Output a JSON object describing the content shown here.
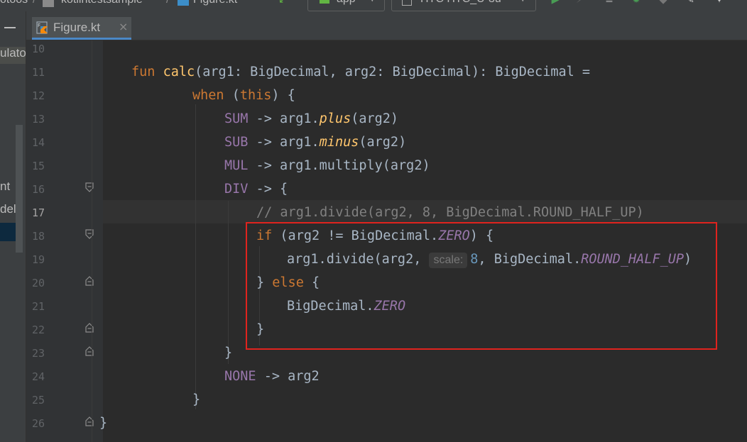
{
  "toolbar": {
    "crumb1": "otoos",
    "crumb2": "kotlintestsample",
    "crumb3": "Figure.kt",
    "run_config": "app",
    "device": "HTC HTC_U-3u"
  },
  "left_panel": {
    "cut_labels": [
      "ulato",
      "nt",
      "del"
    ]
  },
  "tab": {
    "label": "Figure.kt",
    "close": "×"
  },
  "gutter": {
    "line_numbers": [
      "10",
      "11",
      "12",
      "13",
      "14",
      "15",
      "16",
      "17",
      "18",
      "19",
      "20",
      "21",
      "22",
      "23",
      "24",
      "25",
      "26"
    ],
    "current_line": "17"
  },
  "code": {
    "l11": {
      "fun": "fun ",
      "name": "calc",
      "rest": "(arg1: BigDecimal, arg2: BigDecimal): BigDecimal ="
    },
    "l12": {
      "when": "when ",
      "p1": "(",
      "this": "this",
      "p2": ") {"
    },
    "l13": {
      "c": "SUM",
      "mid": " -> arg1.",
      "f": "plus",
      "end": "(arg2)"
    },
    "l14": {
      "c": "SUB",
      "mid": " -> arg1.",
      "f": "minus",
      "end": "(arg2)"
    },
    "l15": {
      "c": "MUL",
      "mid": " -> arg1.multiply(arg2)"
    },
    "l16": {
      "c": "DIV",
      "mid": " -> {"
    },
    "l17": {
      "comment": "// arg1.divide(arg2, 8, BigDecimal.ROUND_HALF_UP)"
    },
    "l18": {
      "if": "if",
      "mid": " (arg2 != BigDecimal.",
      "zero": "ZERO",
      "end": ") {"
    },
    "l19": {
      "start": "arg1.divide(arg2, ",
      "hint": "scale:",
      "num": "8",
      "mid": ", BigDecimal.",
      "round": "ROUND_HALF_UP",
      "end": ")"
    },
    "l20": {
      "close": "} ",
      "else": "else",
      "open": " {"
    },
    "l21": {
      "start": "BigDecimal.",
      "zero": "ZERO"
    },
    "l22": {
      "text": "}"
    },
    "l23": {
      "text": "}"
    },
    "l24": {
      "c": "NONE",
      "mid": " -> arg2"
    },
    "l25": {
      "text": "}"
    },
    "l26": {
      "text": "}"
    }
  },
  "colors": {
    "keyword": "#cc7832",
    "function": "#ffc66d",
    "constant": "#9876aa",
    "comment": "#808080",
    "number": "#6897bb",
    "highlight_box": "#e0231e"
  }
}
